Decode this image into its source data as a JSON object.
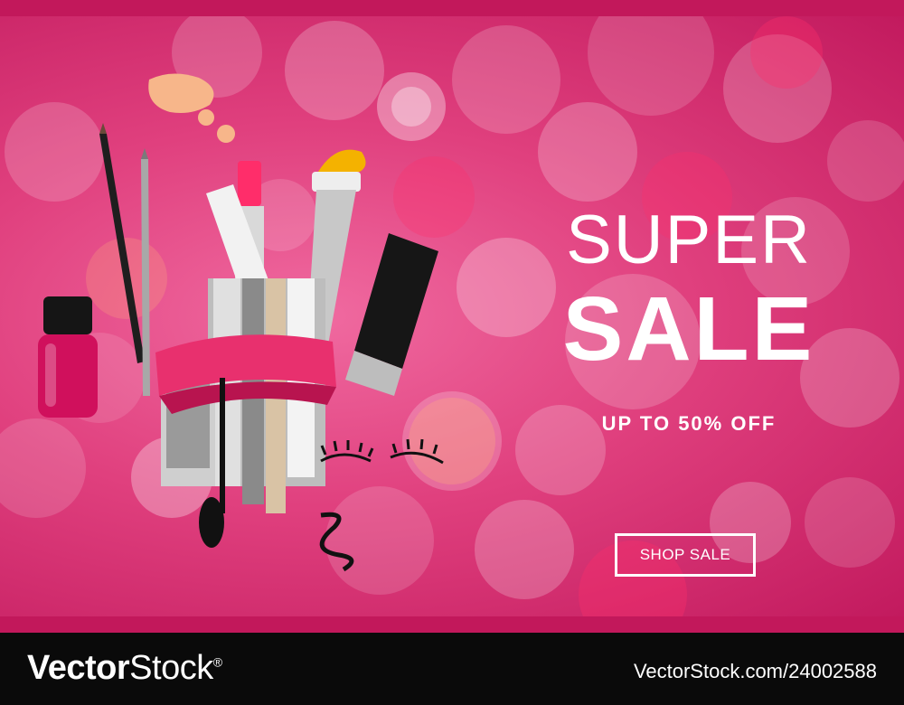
{
  "banner": {
    "headline_top": "SUPER",
    "headline_main": "SALE",
    "subline": "UP TO 50% OFF",
    "cta_label": "SHOP SALE"
  },
  "footer": {
    "brand_bold": "Vector",
    "brand_regular": "Stock",
    "brand_mark": "®",
    "image_id": "VectorStock.com/24002588"
  },
  "colors": {
    "banner_pink": "#e0407e",
    "strip_magenta": "#c2185b",
    "footer_black": "#0a0a0a",
    "nail_polish": "#d0105c",
    "ribbon": "#e8306e"
  },
  "icons": [
    "nail-polish-icon",
    "pencil-icon",
    "lipstick-icon",
    "brush-icon",
    "mascara-icon",
    "tube-icon",
    "eyelash-icon",
    "makeup-swatch-icon"
  ]
}
